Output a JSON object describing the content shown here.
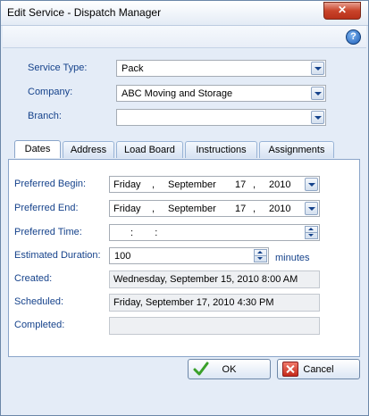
{
  "window": {
    "title": "Edit Service - Dispatch Manager",
    "close_label": "✕"
  },
  "toolbar": {
    "help_label": "?"
  },
  "form": {
    "service_type": {
      "label": "Service Type:",
      "value": "Pack"
    },
    "company": {
      "label": "Company:",
      "value": "ABC Moving and Storage"
    },
    "branch": {
      "label": "Branch:",
      "value": ""
    }
  },
  "tabs": [
    {
      "label": "Dates",
      "active": true
    },
    {
      "label": "Address"
    },
    {
      "label": "Load Board"
    },
    {
      "label": "Instructions"
    },
    {
      "label": "Assignments"
    }
  ],
  "dates": {
    "preferred_begin": {
      "label": "Preferred Begin:",
      "weekday": "Friday",
      "month": "September",
      "day": "17",
      "year": "2010"
    },
    "preferred_end": {
      "label": "Preferred End:",
      "weekday": "Friday",
      "month": "September",
      "day": "17",
      "year": "2010"
    },
    "preferred_time": {
      "label": "Preferred Time:",
      "value": " :  : "
    },
    "estimated_duration": {
      "label": "Estimated Duration:",
      "value": "100",
      "unit": "minutes"
    },
    "created": {
      "label": "Created:",
      "value": "Wednesday, September 15, 2010 8:00 AM"
    },
    "scheduled": {
      "label": "Scheduled:",
      "value": "Friday, September 17, 2010 4:30 PM"
    },
    "completed": {
      "label": "Completed:",
      "value": ""
    }
  },
  "footer": {
    "ok_label": "OK",
    "cancel_label": "Cancel"
  },
  "colors": {
    "label_blue": "#15428b",
    "window_bg": "#e4ecf7",
    "tab_border": "#8aa5c9"
  }
}
